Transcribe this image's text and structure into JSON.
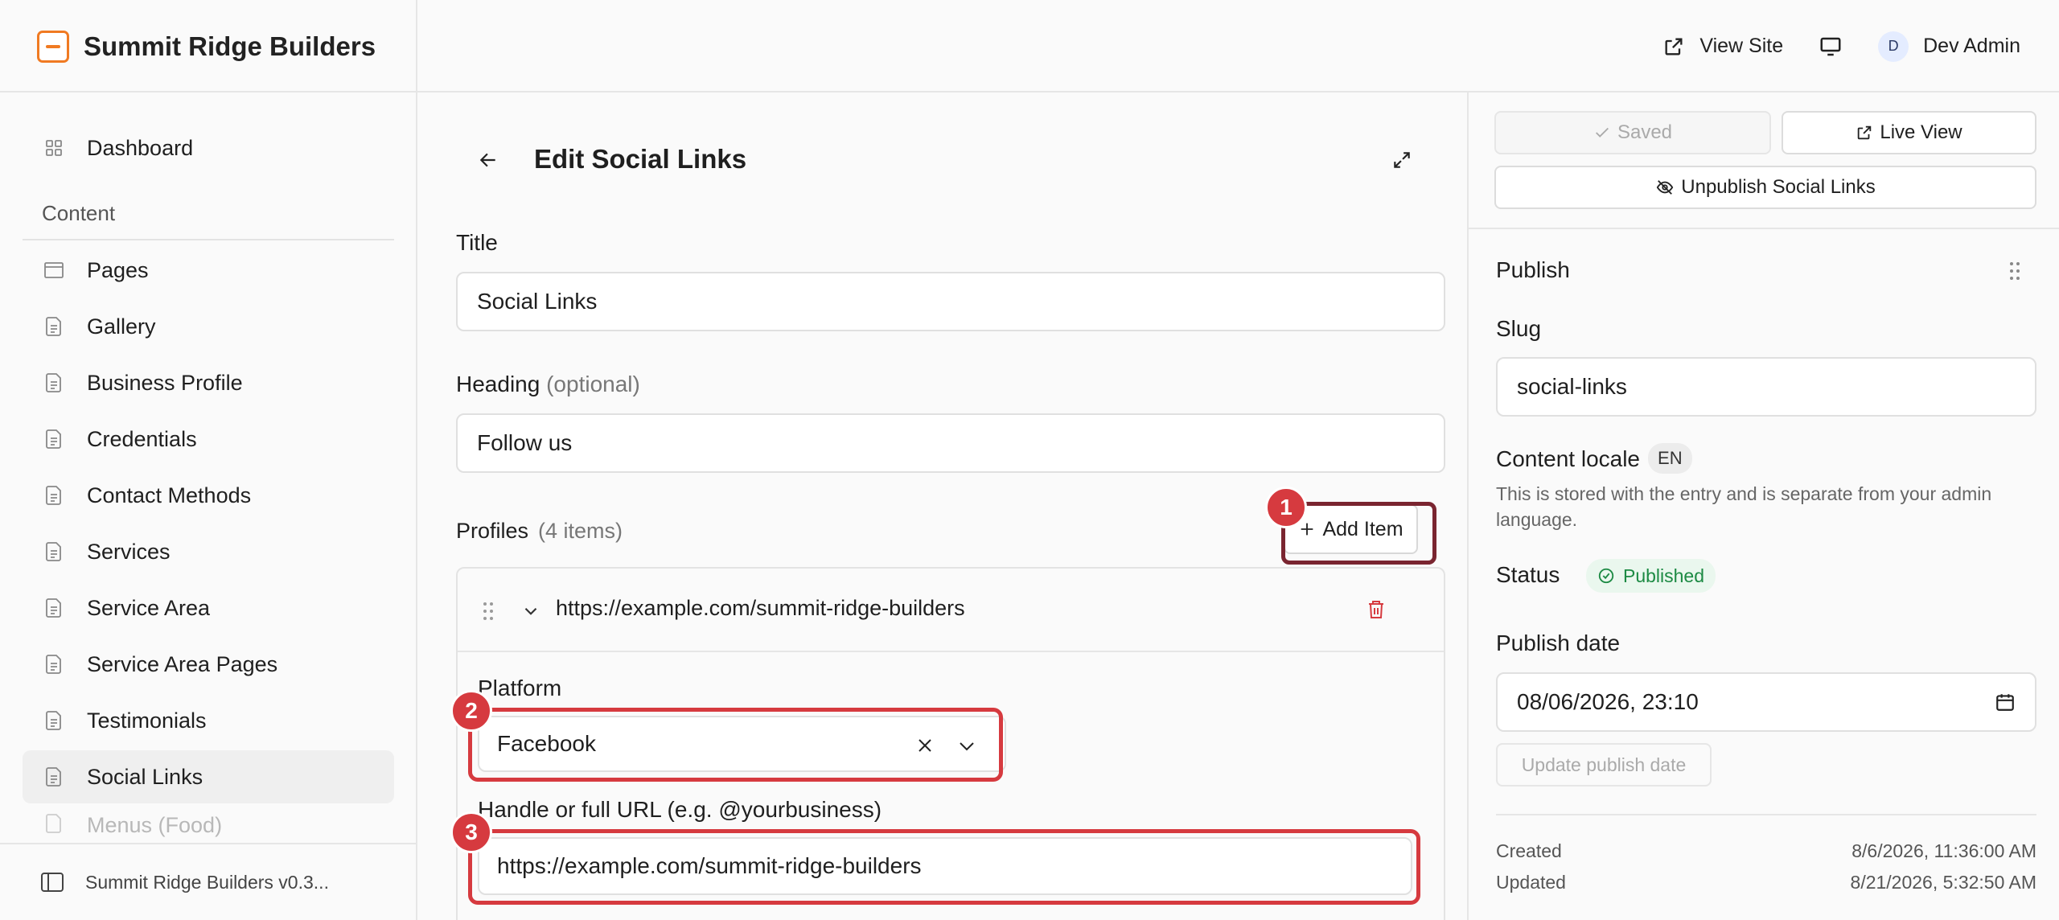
{
  "brand": {
    "name": "Summit Ridge Builders"
  },
  "topbar": {
    "view_site": "View Site",
    "user_initial": "D",
    "user_name": "Dev Admin"
  },
  "sidebar": {
    "dashboard": "Dashboard",
    "section": "Content",
    "items": [
      "Pages",
      "Gallery",
      "Business Profile",
      "Credentials",
      "Contact Methods",
      "Services",
      "Service Area",
      "Service Area Pages",
      "Testimonials",
      "Social Links",
      "Menus (Food)"
    ],
    "active": "Social Links",
    "footer": "Summit Ridge Builders v0.3..."
  },
  "editor": {
    "title": "Edit Social Links",
    "title_label": "Title",
    "title_value": "Social Links",
    "heading_label": "Heading",
    "heading_optional": "(optional)",
    "heading_value": "Follow us",
    "profiles_label": "Profiles",
    "profiles_count": "(4 items)",
    "add_item": "Add Item",
    "item_url": "https://example.com/summit-ridge-builders",
    "platform_label": "Platform",
    "platform_value": "Facebook",
    "handle_label": "Handle or full URL (e.g. @yourbusiness)",
    "handle_value": "https://example.com/summit-ridge-builders"
  },
  "annotations": [
    "1",
    "2",
    "3"
  ],
  "panel": {
    "saved": "Saved",
    "live_view": "Live View",
    "unpublish": "Unpublish Social Links",
    "publish_heading": "Publish",
    "slug_label": "Slug",
    "slug_value": "social-links",
    "locale_label": "Content locale",
    "locale_value": "EN",
    "locale_note": "This is stored with the entry and is separate from your admin language.",
    "status_label": "Status",
    "status_value": "Published",
    "publish_date_label": "Publish date",
    "publish_date_value": "08/06/2026, 23:10",
    "update_publish_date": "Update publish date",
    "created_label": "Created",
    "created_value": "8/6/2026, 11:36:00 AM",
    "updated_label": "Updated",
    "updated_value": "8/21/2026, 5:32:50 AM"
  },
  "colors": {
    "accent": "#f07a22",
    "highlight": "#d63a3f",
    "highlight_dark": "#7a2530",
    "success": "#1c8a43"
  }
}
